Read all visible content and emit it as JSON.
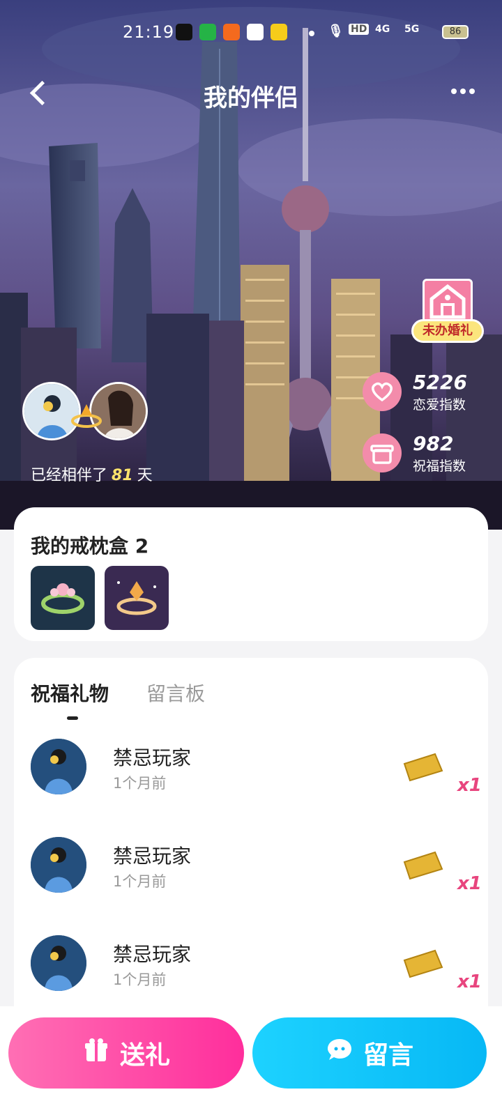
{
  "status_bar": {
    "time": "21:19",
    "apps": [
      "tiktok-icon",
      "iqiyi-icon",
      "kuaishou-icon",
      "photos-icon",
      "meituan-icon"
    ],
    "signal1": "4G",
    "signal2": "5G",
    "hd": "HD",
    "battery": "86"
  },
  "header": {
    "title": "我的伴侣"
  },
  "wedding_badge": {
    "label": "未办婚礼"
  },
  "stats": [
    {
      "value": "5226",
      "label": "恋爱指数",
      "icon": "heart-cup-icon"
    },
    {
      "value": "982",
      "label": "祝福指数",
      "icon": "gift-box-icon"
    }
  ],
  "days": {
    "prefix": "已经相伴了",
    "count": "81",
    "suffix": "天"
  },
  "ring_box": {
    "title": "我的戒枕盒 2"
  },
  "tabs": [
    {
      "label": "祝福礼物",
      "active": true
    },
    {
      "label": "留言板",
      "active": false
    }
  ],
  "gift_list": [
    {
      "name": "禁忌玩家",
      "time": "1个月前",
      "qty": "x1"
    },
    {
      "name": "禁忌玩家",
      "time": "1个月前",
      "qty": "x1"
    },
    {
      "name": "禁忌玩家",
      "time": "1个月前",
      "qty": "x1"
    }
  ],
  "actions": {
    "gift_label": "送礼",
    "message_label": "留言"
  },
  "colors": {
    "pink": "#ff2e9c",
    "cyan": "#07b8f5",
    "qty": "#e8457e",
    "badge": "#fbe57d"
  }
}
